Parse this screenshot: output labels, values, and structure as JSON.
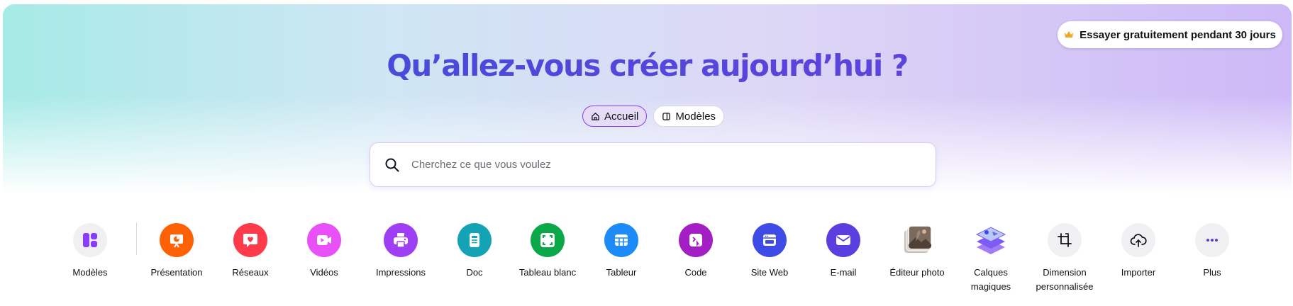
{
  "trial": {
    "label": "Essayer gratuitement pendant 30 jours",
    "icon": "crown-icon"
  },
  "title": "Qu’allez-vous créer aujourd’hui ?",
  "tabs": [
    {
      "label": "Accueil",
      "icon": "home-icon",
      "active": true
    },
    {
      "label": "Modèles",
      "icon": "template-icon",
      "active": false
    }
  ],
  "search": {
    "placeholder": "Cherchez ce que vous voulez",
    "value": ""
  },
  "categories": [
    {
      "label": "Modèles",
      "icon": "layout-icon",
      "color": "#f0f0f3"
    },
    {
      "label": "Présentation",
      "icon": "presentation-icon",
      "color": "#ff6105"
    },
    {
      "label": "Réseaux",
      "icon": "social-heart-icon",
      "color": "#ff3b4b"
    },
    {
      "label": "Vidéos",
      "icon": "video-icon",
      "color": "#e950f7"
    },
    {
      "label": "Impressions",
      "icon": "printer-icon",
      "color": "#9e3ef5"
    },
    {
      "label": "Doc",
      "icon": "doc-icon",
      "color": "#13a3b5"
    },
    {
      "label": "Tableau blanc",
      "icon": "whiteboard-icon",
      "color": "#0ba84a"
    },
    {
      "label": "Tableur",
      "icon": "spreadsheet-icon",
      "color": "#1d8bf7"
    },
    {
      "label": "Code",
      "icon": "code-icon",
      "color": "#a31ec3"
    },
    {
      "label": "Site Web",
      "icon": "website-icon",
      "color": "#3f4be6"
    },
    {
      "label": "E-mail",
      "icon": "mail-icon",
      "color": "#5a3ee0"
    },
    {
      "label": "Éditeur photo",
      "icon": "photo-editor-icon",
      "color": "#8a7b70"
    },
    {
      "label": "Calques magiques",
      "icon": "magic-layers-icon",
      "color": "#7d5cf5"
    },
    {
      "label": "Dimension personnalisée",
      "icon": "custom-size-icon",
      "color": "#f0f0f3"
    },
    {
      "label": "Importer",
      "icon": "upload-cloud-icon",
      "color": "#f0f0f3"
    },
    {
      "label": "Plus",
      "icon": "more-icon",
      "color": "#f0f0f3"
    }
  ]
}
